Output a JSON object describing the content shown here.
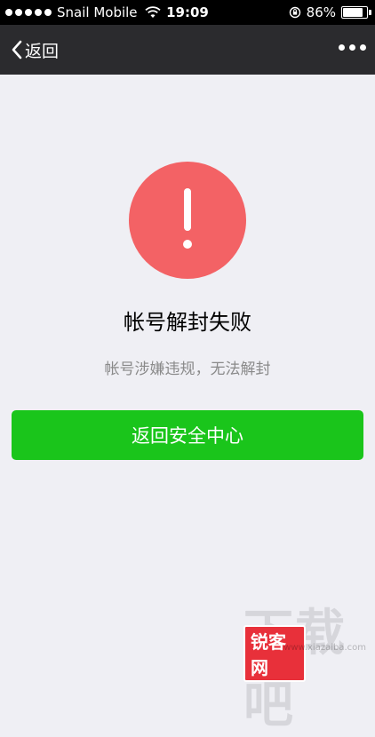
{
  "status_bar": {
    "carrier": "Snail Mobile",
    "time": "19:09",
    "battery": "86%",
    "battery_level": 0.86
  },
  "nav": {
    "back_label": "返回"
  },
  "alert": {
    "title": "帐号解封失败",
    "message": "帐号涉嫌违规，无法解封",
    "color": "#f36265"
  },
  "button": {
    "label": "返回安全中心",
    "color": "#1ac51b"
  },
  "watermark": {
    "text": "下载吧",
    "badge": "锐客网",
    "url": "www.xiazaiba.com"
  }
}
